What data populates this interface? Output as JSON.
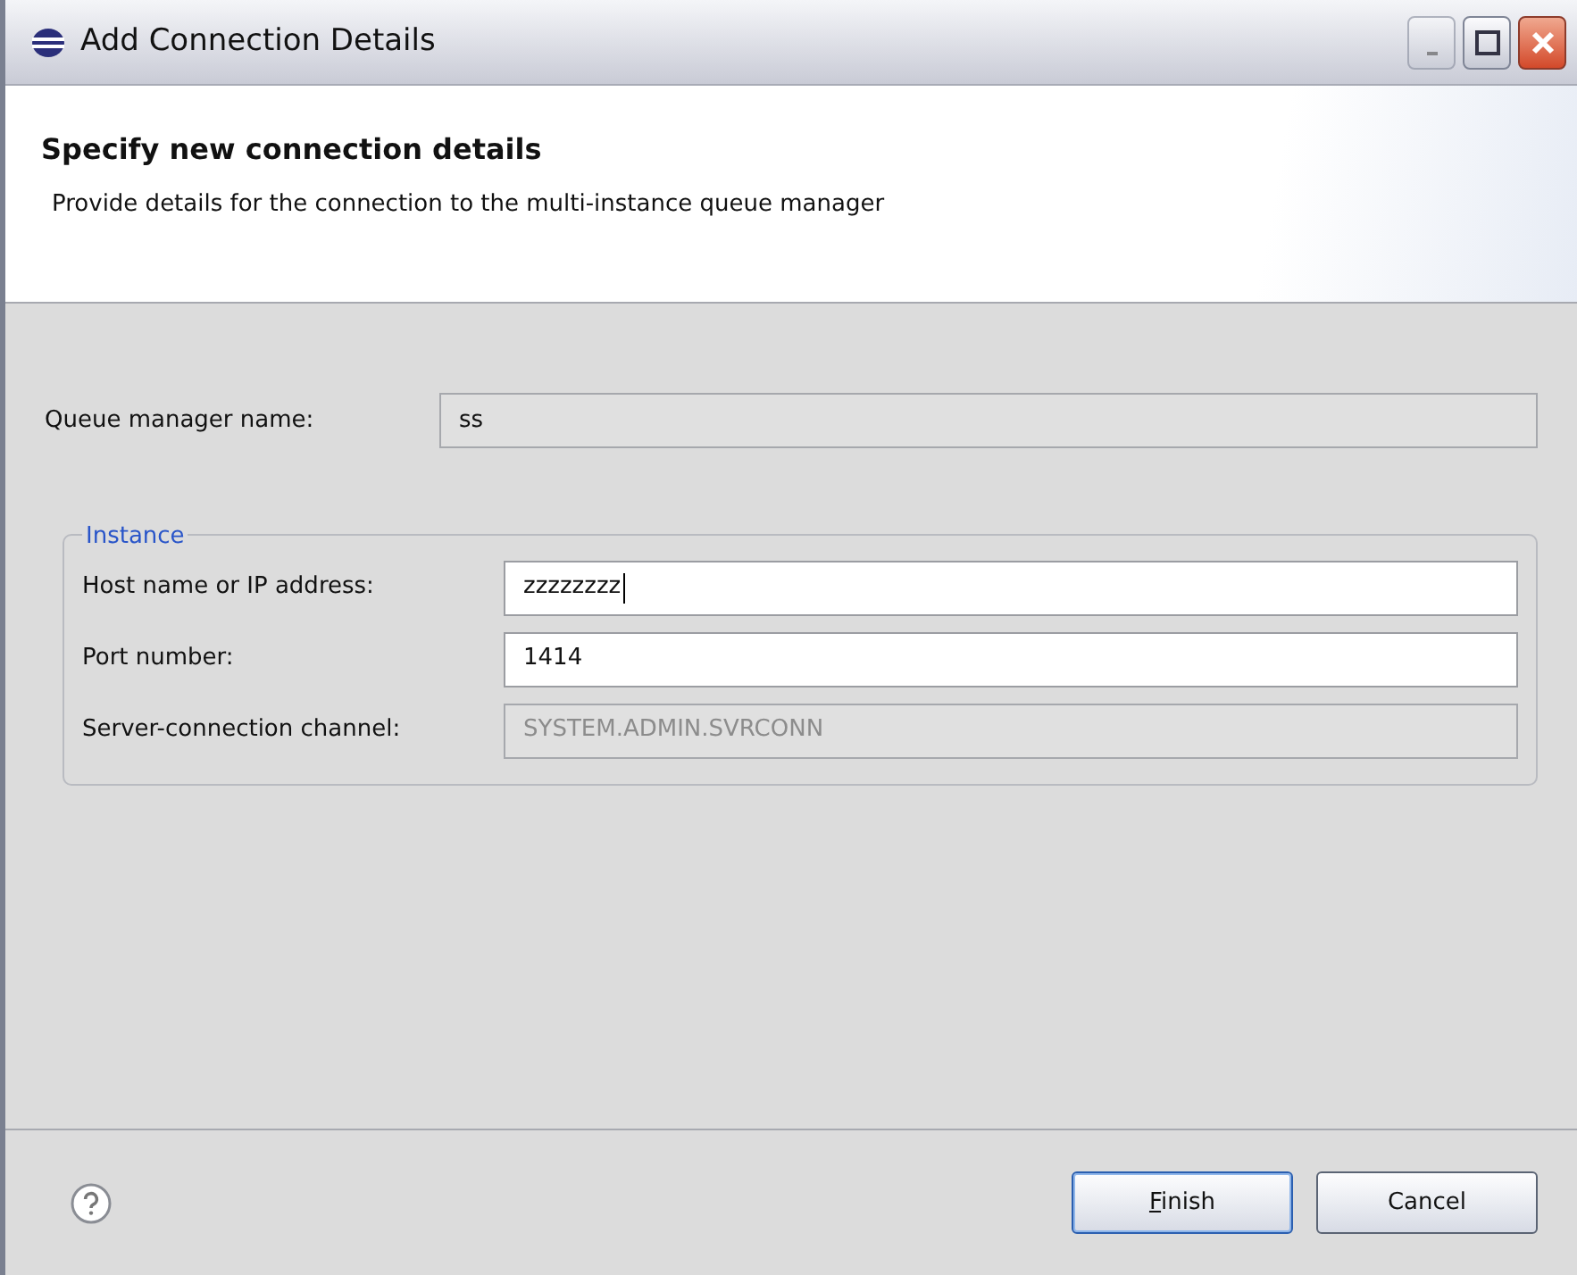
{
  "window": {
    "title": "Add Connection Details",
    "buttons": [
      {
        "kind": "minimize",
        "disabled": true
      },
      {
        "kind": "maximize",
        "disabled": false
      },
      {
        "kind": "close",
        "disabled": false
      }
    ]
  },
  "header": {
    "title": "Specify new connection details",
    "description": "Provide details for the connection to the multi-instance queue manager"
  },
  "queue_manager": {
    "label": "Queue manager name:",
    "value": "ss",
    "kind": "readonly"
  },
  "group": {
    "title": "Instance",
    "fields": [
      {
        "label": "Host name or IP address:",
        "value": "zzzzzzzz",
        "kind": "editable",
        "focused": true
      },
      {
        "label": "Port number:",
        "value": "1414",
        "kind": "editable",
        "focused": false
      },
      {
        "label": "Server-connection channel:",
        "value": "SYSTEM.ADMIN.SVRCONN",
        "kind": "disabled",
        "focused": false
      }
    ]
  },
  "footer": {
    "buttons": [
      {
        "label": "Finish",
        "default": true,
        "mnemonic": true
      },
      {
        "label": "Cancel",
        "default": false,
        "mnemonic": false
      }
    ]
  }
}
